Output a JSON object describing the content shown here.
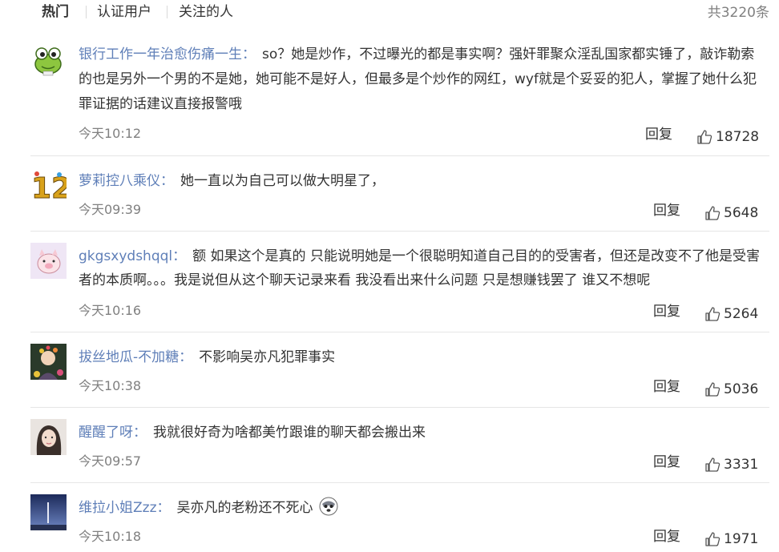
{
  "tabs": [
    {
      "label": "热门"
    },
    {
      "label": "认证用户"
    },
    {
      "label": "关注的人"
    }
  ],
  "total": "共3220条",
  "reply_label": "回复",
  "colors": {
    "username": "#5f7fb8",
    "text": "#333333",
    "meta": "#808080",
    "divider": "#e6e6e6"
  },
  "comments": [
    {
      "user": "银行工作一年治愈伤痛一生",
      "text": "so？她是炒作，不过曝光的都是事实啊？强奸罪聚众淫乱国家都实锤了，敲诈勒索的也是另外一个男的不是她，她可能不是好人，但最多是个炒作的网红，wyf就是个妥妥的犯人，掌握了她什么犯罪证据的话建议直接报警哦",
      "time": "今天10:12",
      "likes": "18728",
      "avatar": "frog-avatar"
    },
    {
      "user": "萝莉控八乘仪",
      "text": "她一直以为自己可以做大明星了，",
      "time": "今天09:39",
      "likes": "5648",
      "avatar": "number-12-avatar"
    },
    {
      "user": "gkgsxydshqql",
      "text": "额 如果这个是真的 只能说明她是一个很聪明知道自己目的的受害者，但还是改变不了他是受害者的本质啊。。。我是说但从这个聊天记录来看 我没看出来什么问题 只是想赚钱罢了 谁又不想呢",
      "time": "今天10:16",
      "likes": "5264",
      "avatar": "pig-avatar"
    },
    {
      "user": "拔丝地瓜-不加糖",
      "text": "不影响吴亦凡犯罪事实",
      "time": "今天10:38",
      "likes": "5036",
      "avatar": "flower-girl-avatar"
    },
    {
      "user": "醒醒了呀",
      "text": "我就很好奇为啥都美竹跟谁的聊天都会搬出来",
      "time": "今天09:57",
      "likes": "3331",
      "avatar": "girl-portrait-avatar"
    },
    {
      "user": "维拉小姐Zzz",
      "text": "吴亦凡的老粉还不死心",
      "time": "今天10:18",
      "likes": "1971",
      "avatar": "sky-avatar",
      "emoji": "husky-emoji"
    }
  ]
}
